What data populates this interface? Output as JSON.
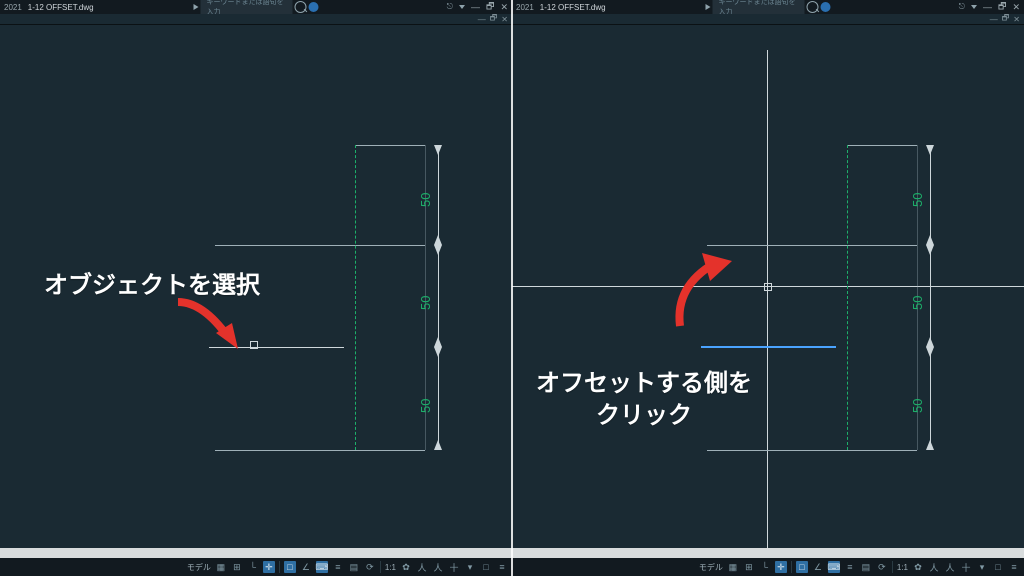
{
  "app": {
    "year": "2021",
    "filename": "1-12 OFFSET.dwg",
    "search_placeholder": "キーワードまたは語句を入力"
  },
  "win": {
    "minimize": "—",
    "restore": "🗗",
    "close": "✕"
  },
  "canvas": {
    "dims": [
      "50",
      "50",
      "50"
    ],
    "annotation_left": "オブジェクトを選択",
    "annotation_right_l1": "オフセットする側を",
    "annotation_right_l2": "クリック"
  },
  "status": {
    "model": "モデル",
    "grid": "▦",
    "snap": "⊞",
    "ortho": "└",
    "polar": "✛",
    "osnap": "□",
    "otrack": "∠",
    "dyn": "⌨",
    "lwt": "≡",
    "trans": "▤",
    "cycle": "⟳",
    "scale": "1:1",
    "anno": "人",
    "gear": "✿",
    "tri": "▾",
    "plus": "十",
    "box": "□",
    "menu": "≡"
  }
}
